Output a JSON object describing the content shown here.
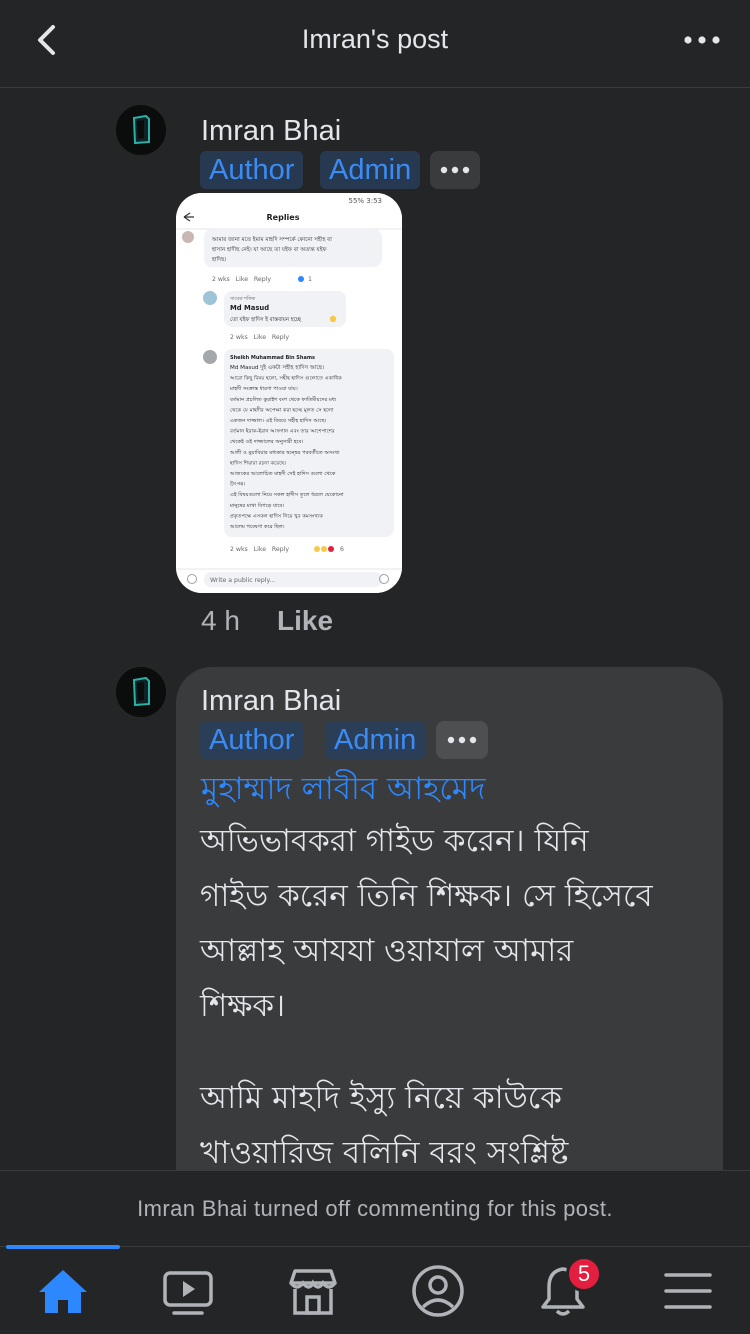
{
  "header": {
    "title": "Imran's post"
  },
  "comments": [
    {
      "author": "Imran Bhai",
      "badges": [
        "Author",
        "Admin"
      ],
      "attachment": {
        "header": "Replies",
        "status": "55% 3:53",
        "lines": [
          "আমার জানা মতে ইমাম মাহদি সম্পর্কে কোনো সহীহ বা",
          "হাসান হাদীছ নেই। যা আছে তা যইফ বা অত্যন্ত যইফ",
          "হাদিছ।"
        ],
        "reply1_meta": "2 wks   Like   Reply",
        "reply1_count": "1",
        "masud_label": "সাবেক শফিক",
        "masud_name": "Md Masud",
        "masud_text": "তো যইফ হাদিস ই বাস্তবায়ন হচ্ছে",
        "masud_meta": "2 wks   Like   Reply",
        "sheikh_name": "Sheikh Muhammad Bin Shams",
        "sheikh_lines": [
          "Md Masud দুই একটা সহীহ হাদিস আছে।",
          "আরো কিছু বিষয় হলো, সহীহ হাদিস গুলোতে একাধিক",
          "মাহদী সংক্রান্ত ধারণা পাওয়া যায়।",
          "বর্তমান প্রচলিত কুরাইশ বংশ থেকে ফাতিমীয়দের মধ্য",
          "থেকে যে মাহদীর অপেক্ষা করা হচ্ছে মূলত সে হলো",
          "একজন দাজ্জাল। এই বিষয়ে সহীহ হাদিস আছে।",
          "বর্তমান ইরাক-ইরান আফগান এবং তার আশেপাশের",
          "থেকেই ওই দাজ্জালের অনুসারী হবে।",
          "আলী ও মুয়াবিয়ার মধ্যকার দ্বন্দ্বের পরবর্তীতে অসংখ্য",
          "হাদিস শিয়ারা রচনা করেছে।",
          "আজকের আলোচিত মাহদী সেই হাদিস গুলো থেকে",
          "উৎপন্ন।",
          "এই বিষয়গুলো নিয়ে সকল হাদীস তুলে ধরলে যেকোনো",
          "মানুষের মাথা বিগড়ে যাবে।",
          "প্রকৃতপক্ষে এসকল হাদিস নিয়ে খুব কমসংখ্যক",
          "আলেম গবেষণা করে ছিল।"
        ],
        "sheikh_meta": "2 wks   Like   Reply",
        "sheikh_count": "6",
        "input_placeholder": "Write a public reply..."
      },
      "time": "4 h",
      "like_label": "Like"
    },
    {
      "author": "Imran Bhai",
      "badges": [
        "Author",
        "Admin"
      ],
      "mention": "মুহাম্মাদ লাবীব আহমেদ",
      "lines": [
        "অভিভাবকরা গাইড করেন। যিনি",
        "গাইড করেন তিনি শিক্ষক। সে হিসেবে",
        "আল্লাহ আযযা ওয়াযাল আমার",
        "শিক্ষক।",
        "আমি মাহদি ইস্যু নিয়ে কাউকে",
        "খাওয়ারিজ বলিনি বরং সংশ্লিষ্ট"
      ]
    }
  ],
  "notice": {
    "name": "Imran Bhai",
    "text": " turned off commenting for this post."
  },
  "tabbar": {
    "notification_count": "5",
    "icons": [
      "home-icon",
      "watch-icon",
      "marketplace-icon",
      "profile-icon",
      "bell-icon",
      "menu-icon"
    ],
    "active_color": "#2d88ff"
  },
  "colors": {
    "background": "#242526",
    "bubble": "#3a3b3c",
    "badge_bg": "#263951",
    "accent": "#2d88ff",
    "notification": "#e41e3f"
  }
}
